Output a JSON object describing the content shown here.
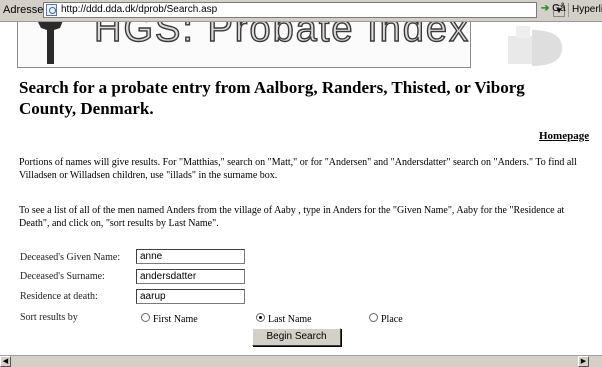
{
  "address_bar": {
    "label": "Adresse",
    "url": "http://ddd.dda.dk/dprob/Search.asp",
    "go_label": "Gå",
    "links_label": "Hyperlinks"
  },
  "header": {
    "banner_text": "HGS: Probate Index"
  },
  "heading": "Search for a probate entry from Aalborg, Randers, Thisted, or Viborg County, Denmark.",
  "homepage_link": "Homepage",
  "paragraphs": [
    "Portions of names will give results. For \"Matthias,\" search on \"Matt,\" or for \"Andersen\" and \"Andersdatter\" search on \"Anders.\" To find all Villadsen or Willadsen children, use \"illads\" in the surname box.",
    "To see a list of all of the men named Anders from the village of Aaby , type in Anders for the \"Given Name\", Aaby for the \"Residence at Death\", and click on, \"sort results by Last Name\"."
  ],
  "form": {
    "given_name": {
      "label": "Deceased's Given Name:",
      "value": "anne"
    },
    "surname": {
      "label": "Deceased's Surname:",
      "value": "andersdatter"
    },
    "residence": {
      "label": "Residence at death:",
      "value": "aarup"
    },
    "sort": {
      "label": "Sort results by",
      "options": [
        "First Name",
        "Last Name",
        "Place"
      ],
      "selected": "Last Name"
    },
    "submit_label": "Begin Search"
  }
}
